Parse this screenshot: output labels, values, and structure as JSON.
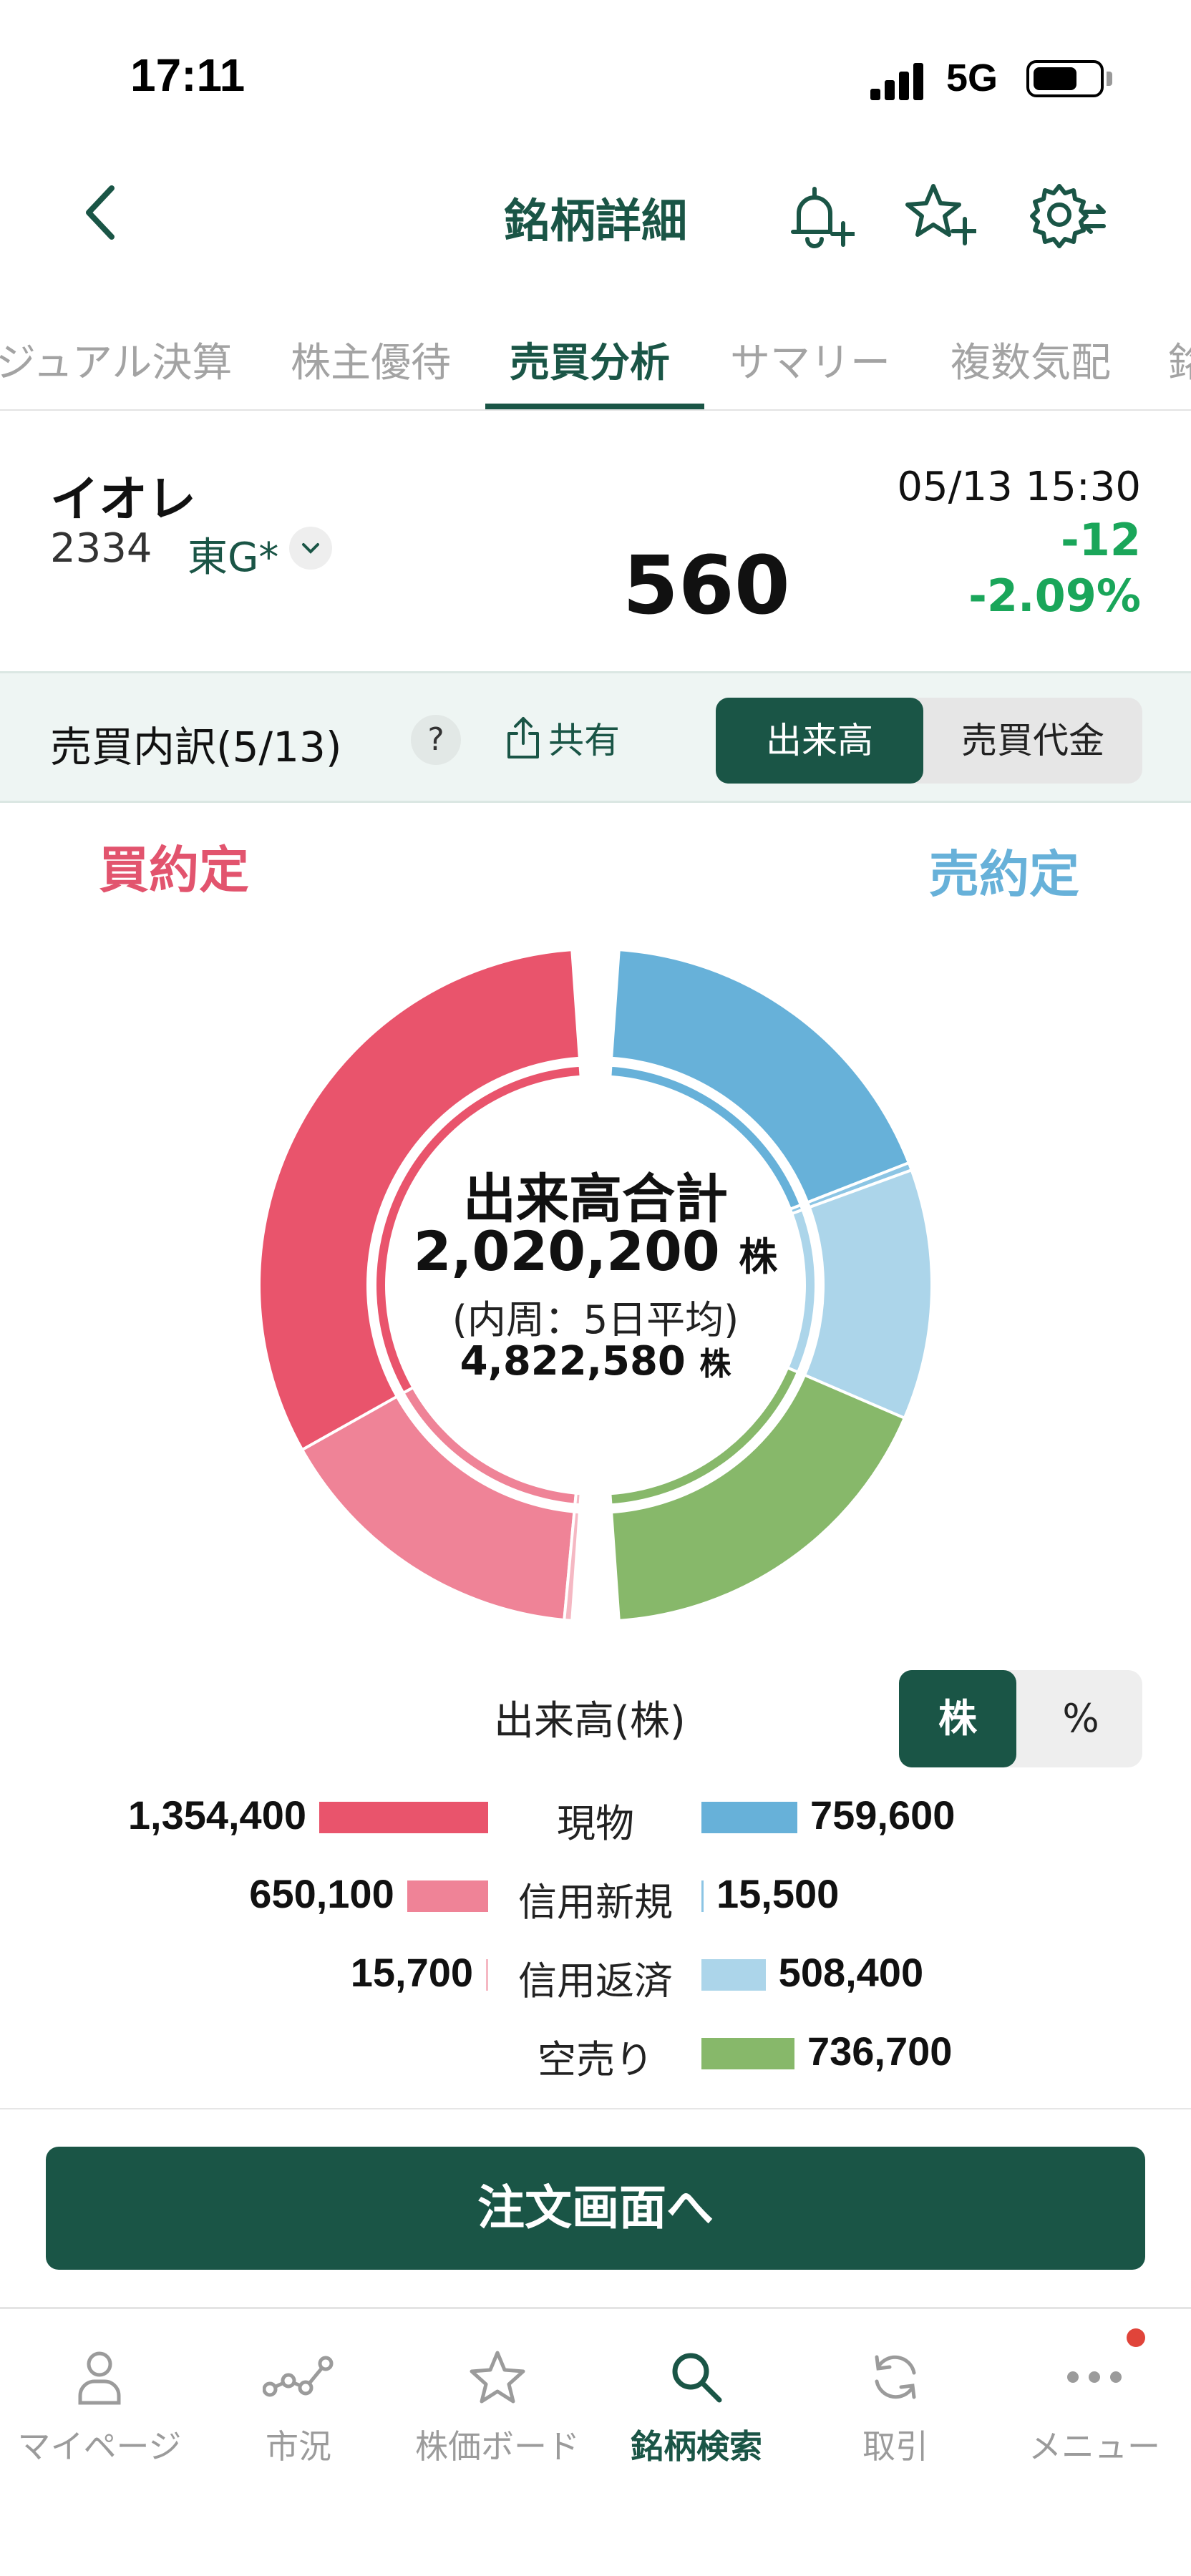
{
  "status_bar": {
    "time": "17:11",
    "network": "5G"
  },
  "header": {
    "title": "銘柄詳細"
  },
  "tabs": [
    {
      "label": "ジュアル決算"
    },
    {
      "label": "株主優待"
    },
    {
      "label": "売買分析"
    },
    {
      "label": "サマリー"
    },
    {
      "label": "複数気配"
    },
    {
      "label": "銘"
    }
  ],
  "stock": {
    "name": "イオレ",
    "code": "2334",
    "market": "東G*",
    "price": "560",
    "datetime": "05/13 15:30",
    "change": "-12",
    "change_pct": "-2.09%"
  },
  "breakdown": {
    "title": "売買内訳(5/13)",
    "help": "?",
    "share_label": "共有",
    "toggle_volume": "出来高",
    "toggle_value": "売買代金"
  },
  "donut": {
    "buy_label": "買約定",
    "sell_label": "売約定",
    "center_title": "出来高合計",
    "total": "2,020,200",
    "unit": "株",
    "avg_label": "(内周：5日平均)",
    "avg_total": "4,822,580"
  },
  "legend": {
    "caption": "出来高(株)",
    "unit_shares": "株",
    "unit_percent": "%",
    "rows": [
      {
        "label": "現物",
        "buy": "1,354,400",
        "sell": "759,600"
      },
      {
        "label": "信用新規",
        "buy": "650,100",
        "sell": "15,500"
      },
      {
        "label": "信用返済",
        "buy": "15,700",
        "sell": "508,400"
      },
      {
        "label": "空売り",
        "buy": "",
        "sell": "736,700"
      }
    ]
  },
  "chart_data": {
    "type": "pie",
    "title": "出来高合計",
    "total": 2020200,
    "inner_ring_total": 4822580,
    "series": [
      {
        "name": "現物",
        "side": "buy",
        "value": 1354400
      },
      {
        "name": "信用新規",
        "side": "buy",
        "value": 650100
      },
      {
        "name": "信用返済",
        "side": "buy",
        "value": 15700
      },
      {
        "name": "現物",
        "side": "sell",
        "value": 759600
      },
      {
        "name": "信用新規",
        "side": "sell",
        "value": 15500
      },
      {
        "name": "信用返済",
        "side": "sell",
        "value": 508400
      },
      {
        "name": "空売り",
        "side": "sell",
        "value": 736700
      }
    ],
    "colors": {
      "buy_genbutsu": "#e9546c",
      "buy_shinyo_shinki": "#ef8397",
      "buy_shinyo_hensai": "#f5b8c3",
      "sell_genbutsu": "#67b1d9",
      "sell_shinyo_shinki": "#8cc5e4",
      "sell_shinyo_hensai": "#acd5ea",
      "sell_karauri": "#87b86a"
    }
  },
  "order_button": {
    "label": "注文画面へ"
  },
  "bottom_nav": [
    {
      "label": "マイページ",
      "icon": "person-icon"
    },
    {
      "label": "市況",
      "icon": "market-icon"
    },
    {
      "label": "株価ボード",
      "icon": "star-icon"
    },
    {
      "label": "銘柄検索",
      "icon": "search-icon"
    },
    {
      "label": "取引",
      "icon": "refresh-icon"
    },
    {
      "label": "メニュー",
      "icon": "more-icon"
    }
  ],
  "colors": {
    "brand": "#1a5546",
    "up": "#e9546c",
    "down": "#1aa65a",
    "sell": "#67b1d9"
  }
}
